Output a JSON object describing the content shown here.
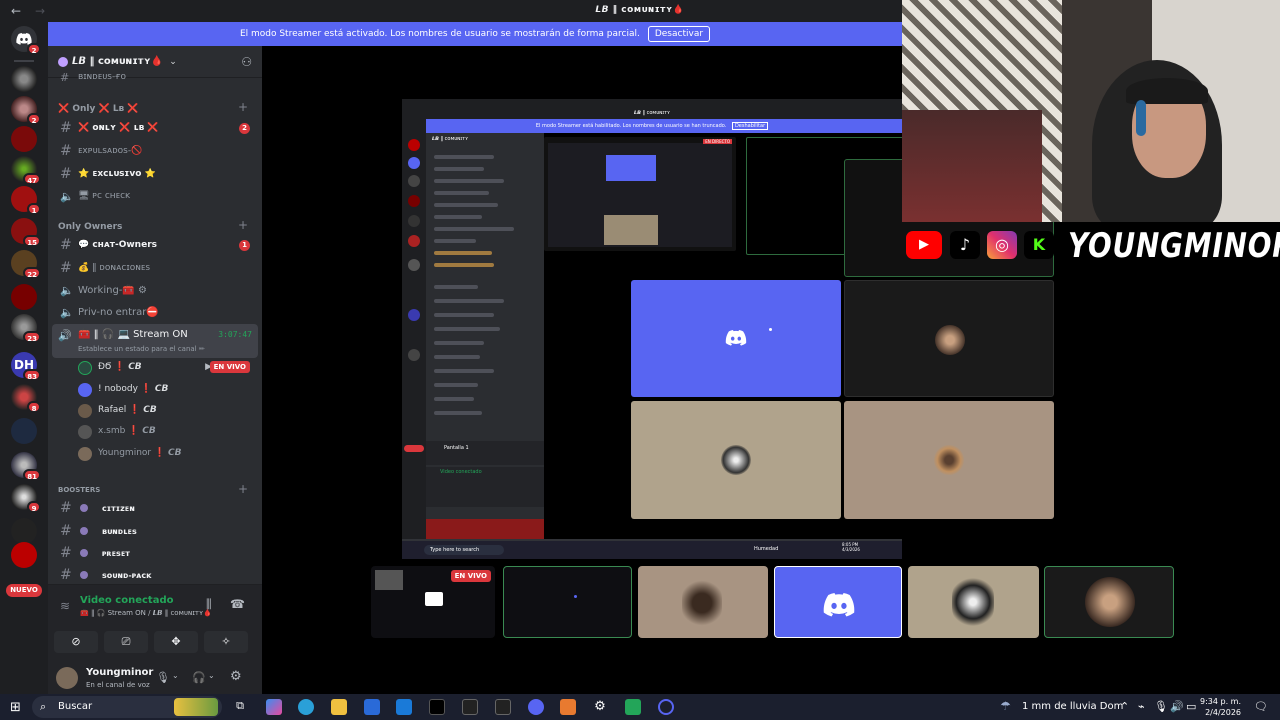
{
  "window": {
    "title": "𝙇𝘽 ‖ ᴄᴏᴍᴜɴɪᴛʏ🩸"
  },
  "streamer_banner": {
    "text": "El modo Streamer está activado. Los nombres de usuario se mostrarán de forma parcial.",
    "button": "Desactivar"
  },
  "guild": {
    "name": "𝙇𝘽 ‖ ᴄᴏᴍᴜɴɪᴛʏ🩸"
  },
  "server_list": {
    "badges": [
      "2",
      "2",
      "47",
      "1",
      "15",
      "22",
      "23",
      "83",
      "8",
      "81",
      "9"
    ],
    "nuevo_label": "NUEVO"
  },
  "channels": [
    {
      "name": "ʙɪɴᴅᴇᴜs-ғᴏ",
      "type": "text",
      "style": "dim"
    },
    {
      "name": "❌ Only ❌ Lʙ ❌",
      "type": "category"
    },
    {
      "name": "❌ ᴏɴʟʏ ❌ ʟʙ ❌",
      "type": "text",
      "style": "bright",
      "mention": "2"
    },
    {
      "name": "ᴇxᴘᴜʟsᴀᴅᴏs-🚫",
      "type": "text",
      "style": "dim"
    },
    {
      "name": "⭐ ᴇxᴄʟᴜsɪᴠᴏ ⭐",
      "type": "text",
      "style": "bright"
    },
    {
      "name": "🖥 ᴘᴄ ᴄʜᴇᴄᴋ",
      "type": "voice",
      "style": "dim"
    },
    {
      "name": "Only Owners",
      "type": "category"
    },
    {
      "name": "💬 ᴄʜᴀᴛ-Owners",
      "type": "text",
      "style": "bright",
      "mention": "1"
    },
    {
      "name": "💰 ‖ ᴅᴏɴᴀᴄɪᴏɴᴇs",
      "type": "text",
      "style": "dim"
    },
    {
      "name": "Working-🧰 ⚙",
      "type": "voice",
      "style": "dim"
    },
    {
      "name": "Priv-no entrar⛔",
      "type": "voice",
      "style": "dim"
    }
  ],
  "active_voice": {
    "name": "🧰 ‖ 🎧 💻 Stream ON",
    "timer": "3:07:47",
    "status": "Establece un estado para el canal ✏"
  },
  "voice_users": [
    {
      "name": "ÐϬ ❗ 𝘾𝘽",
      "live": "EN VIVO"
    },
    {
      "name": "! nobody ❗ 𝘾𝘽"
    },
    {
      "name": "Rafael ❗ 𝘾𝘽"
    },
    {
      "name": "x.smb ❗ 𝘾𝘽"
    },
    {
      "name": "Youngminor ❗ 𝘾𝘽"
    }
  ],
  "boosters": {
    "category": "BOOSTERS",
    "channels": [
      "ᴄɪᴛɪᴢᴇɴ",
      "ʙᴜɴᴅʟᴇs",
      "ᴘʀᴇsᴇᴛ",
      "sᴏᴜɴᴅ-ᴘᴀᴄᴋ"
    ]
  },
  "voice_panel": {
    "status": "Video conectado",
    "channel": "🧰 ‖ 🎧 Stream ON / 𝙇𝘽 ‖ ᴄᴏᴍᴜɴɪᴛʏ🩸"
  },
  "user_panel": {
    "name": "Youngminor",
    "status": "En el canal de voz"
  },
  "screenshare": {
    "inner_banner": "El modo Streamer está habilitado. Los nombres de usuario se han truncado.",
    "inner_button": "Deshabilitar",
    "inner_guild": "𝙇𝘽 ‖ ᴄᴏᴍᴜɴɪᴛʏ",
    "inner_live": "EN DIRECTO",
    "inner_search": "Type here to search",
    "inner_clock": "8:05 PM\n4/3/2026",
    "inner_pantalla": "Pantalla 1",
    "inner_vc": "Video conectado",
    "inner_weather": "Humedad"
  },
  "strip": {
    "live": "EN VIVO"
  },
  "brand": {
    "name": "YOUNGMINOR"
  },
  "taskbar": {
    "search": "Buscar",
    "weather": "1 mm de lluvia Dom",
    "time": "9:34 p. m.",
    "date": "2/4/2026"
  },
  "colors": {
    "blurple": "#5865f2",
    "green": "#23a559",
    "red": "#da373c",
    "sidebar": "#2b2d31",
    "tile_beige": "#b3a48c"
  }
}
